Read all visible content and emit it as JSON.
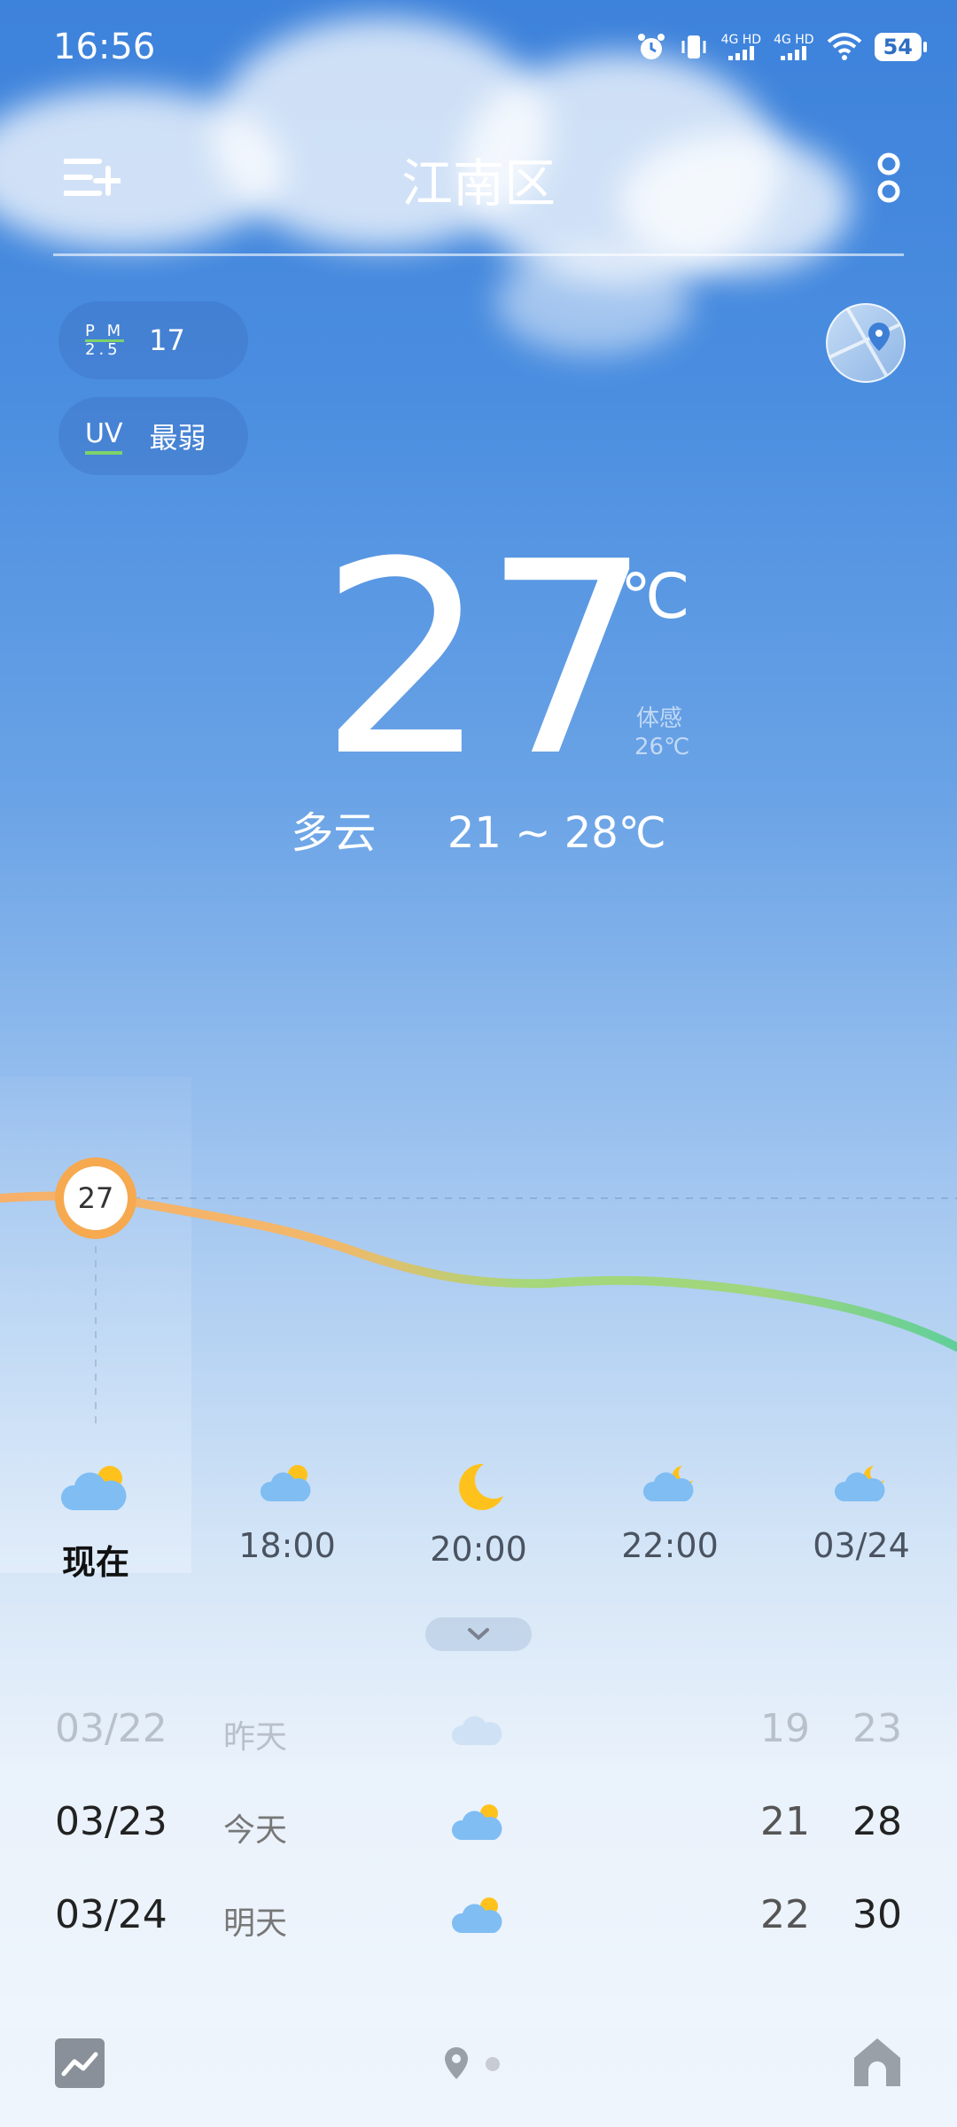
{
  "status_bar": {
    "time": "16:56",
    "net1": "4G HD",
    "net2": "4G HD",
    "battery": "54"
  },
  "header": {
    "city": "江南区",
    "menu_icon": "list-add-icon",
    "more_icon": "more-dots-icon"
  },
  "air": {
    "pm_label_top": "P M",
    "pm_label_bottom": "2.5",
    "pm_value": "17",
    "uv_label": "UV",
    "uv_value": "最弱"
  },
  "current": {
    "temp": "27",
    "unit": "℃",
    "feels_label": "体感",
    "feels_value": "26℃",
    "condition": "多云",
    "range": "21 ~ 28℃"
  },
  "hourly": {
    "marker_temp": "27",
    "items": [
      {
        "label": "现在",
        "icon": "partly-cloudy-day-icon"
      },
      {
        "label": "18:00",
        "icon": "partly-cloudy-day-icon"
      },
      {
        "label": "20:00",
        "icon": "moon-icon"
      },
      {
        "label": "22:00",
        "icon": "partly-cloudy-night-icon"
      },
      {
        "label": "03/24",
        "icon": "partly-cloudy-night-icon"
      }
    ]
  },
  "daily": [
    {
      "date": "03/22",
      "name": "昨天",
      "icon": "cloudy-icon",
      "low": "19",
      "high": "23"
    },
    {
      "date": "03/23",
      "name": "今天",
      "icon": "partly-cloudy-day-icon",
      "low": "21",
      "high": "28"
    },
    {
      "date": "03/24",
      "name": "明天",
      "icon": "partly-cloudy-day-icon",
      "low": "22",
      "high": "30"
    }
  ],
  "colors": {
    "sky_top": "#3d82db",
    "marker": "#f6a94f",
    "curve_warm": "#f6b06a",
    "curve_mid": "#a6d77a",
    "curve_cool": "#5fcf9a"
  }
}
